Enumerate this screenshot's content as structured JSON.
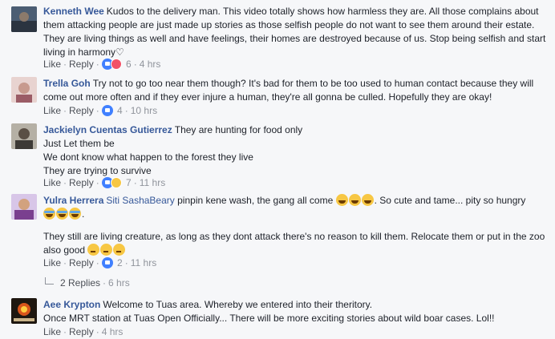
{
  "comments": [
    {
      "author": "Kenneth Wee",
      "text": "Kudos to the delivery man. This video totally shows how harmless they are. All those complains about them attacking people are just made up stories as those selfish people do not want to see them around their estate. They are living things as well and have feelings, their homes are destroyed because of us. Stop being selfish and start living in harmony♡",
      "like_label": "Like",
      "reply_label": "Reply",
      "reaction_count": "6",
      "time": "4 hrs",
      "avatar_color": "#4b5d73"
    },
    {
      "author": "Trella Goh",
      "text": "Try not to go too near them though? It's bad for them to be too used to human contact because they will come out more often and if they ever injure a human, they're all gonna be culled. Hopefully they are okay!",
      "like_label": "Like",
      "reply_label": "Reply",
      "reaction_count": "4",
      "time": "10 hrs",
      "avatar_color": "#b97f86"
    },
    {
      "author": "Jackielyn Cuentas Gutierrez",
      "lines": [
        "They are hunting for food only",
        "Just Let them be",
        "We dont know what happen to the forest they live",
        "They are trying to survive"
      ],
      "like_label": "Like",
      "reply_label": "Reply",
      "reaction_count": "7",
      "time": "11 hrs",
      "avatar_color": "#6f6a60"
    },
    {
      "author": "Yulra Herrera",
      "mention": "Siti SashaBeary",
      "text_a": "pinpin kene wash, the gang all come",
      "text_b": ". So cute and tame... pity so hungry",
      "text_c": ".",
      "paragraph2": "They still are living creature, as long as they dont attack there's no reason to kill them. Relocate them or put in the zoo also good",
      "like_label": "Like",
      "reply_label": "Reply",
      "reaction_count": "2",
      "time": "11 hrs",
      "avatar_color": "#8a5fa8"
    },
    {
      "author": "Aee Krypton",
      "lines": [
        "Welcome to Tuas area. Whereby we entered into their theritory.",
        "Once MRT station at Tuas Open Officially... There will be more exciting stories about wild boar cases. Lol!!"
      ],
      "like_label": "Like",
      "reply_label": "Reply",
      "time": "4 hrs",
      "avatar_color": "#3a2a1a"
    }
  ],
  "replies_link": {
    "label": "2 Replies",
    "time": "6 hrs"
  },
  "colors": {
    "name": "#365899",
    "meta": "#90949c",
    "background": "#f6f7f9"
  }
}
